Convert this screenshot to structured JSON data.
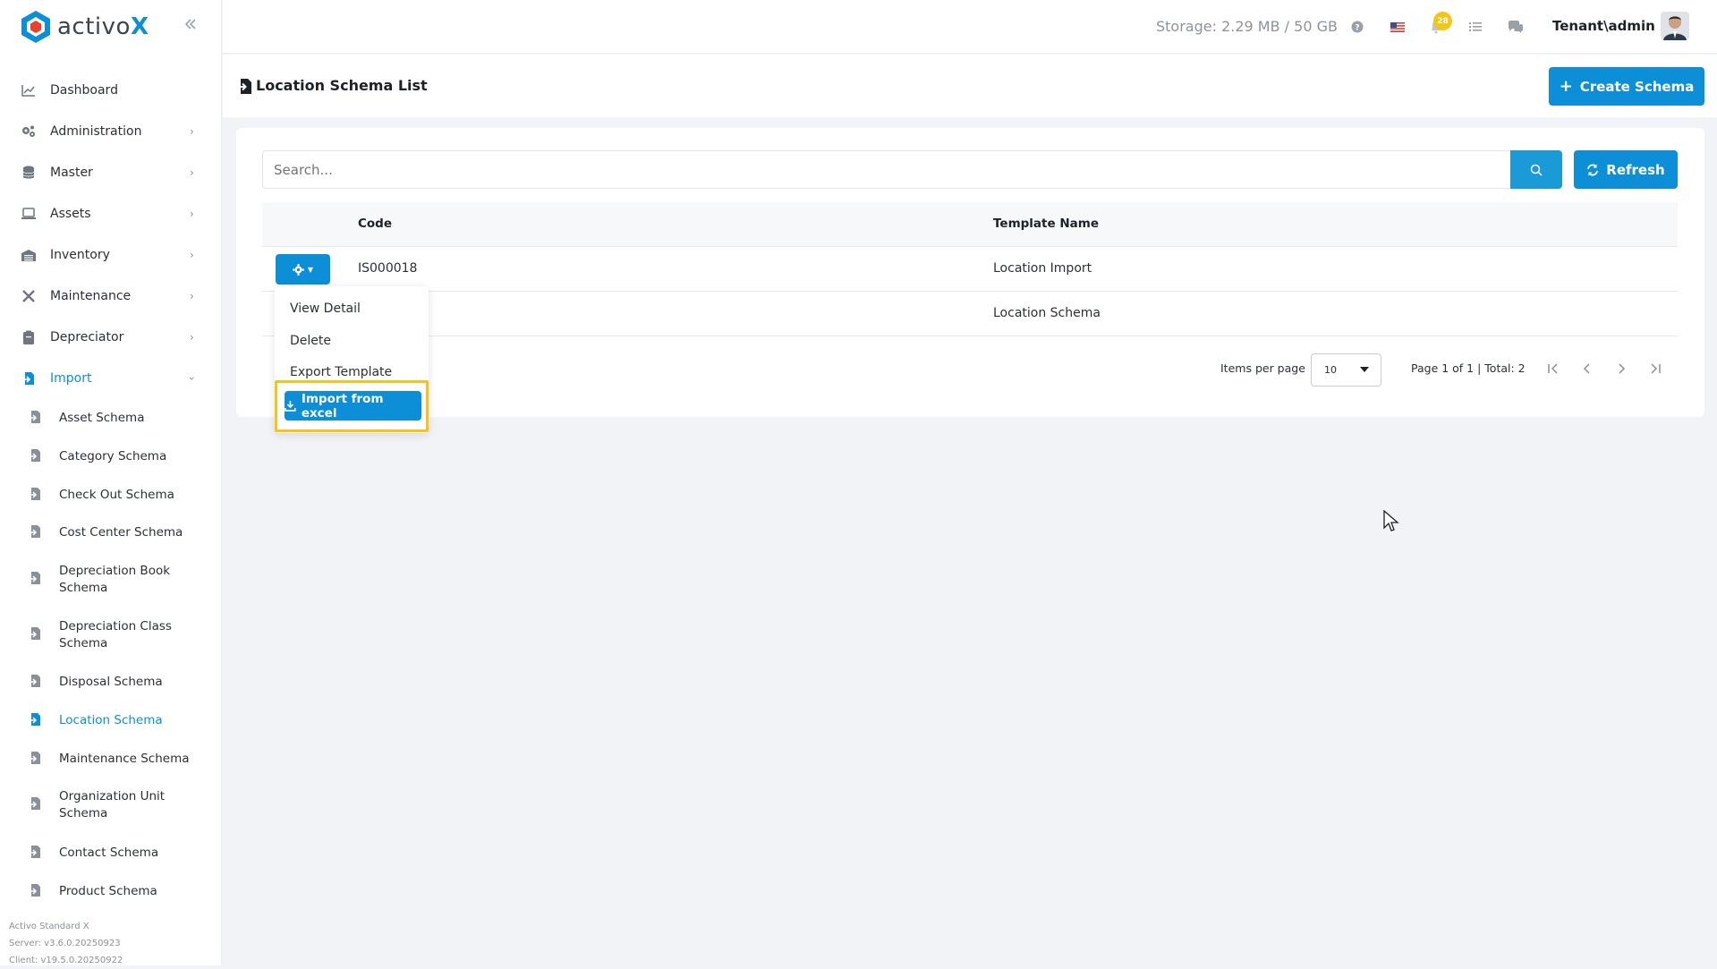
{
  "app": {
    "logo_text": "activo",
    "logo_x": "X"
  },
  "topbar": {
    "storage": "Storage: 2.29 MB / 50 GB",
    "notification_count": "28",
    "user": "Tenant\\admin",
    "icons": [
      "help-icon",
      "flag-us-icon",
      "bell-icon",
      "tasks-icon",
      "chat-icon"
    ]
  },
  "sidebar": {
    "items": [
      {
        "label": "Dashboard",
        "icon": "chart-icon"
      },
      {
        "label": "Administration",
        "icon": "gears-icon"
      },
      {
        "label": "Master",
        "icon": "database-icon"
      },
      {
        "label": "Assets",
        "icon": "laptop-icon"
      },
      {
        "label": "Inventory",
        "icon": "warehouse-icon"
      },
      {
        "label": "Maintenance",
        "icon": "tools-icon"
      },
      {
        "label": "Depreciator",
        "icon": "clipboard-icon"
      },
      {
        "label": "Import",
        "icon": "import-icon"
      }
    ],
    "subitems": [
      "Asset Schema",
      "Category Schema",
      "Check Out Schema",
      "Cost Center Schema",
      "Depreciation Book Schema",
      "Depreciation Class Schema",
      "Disposal Schema",
      "Location Schema",
      "Maintenance Schema",
      "Organization Unit Schema",
      "Contact Schema",
      "Product Schema"
    ],
    "footer": [
      "Activo Standard X",
      "Server: v3.6.0.20250923",
      "Client: v19.5.0.20250922"
    ]
  },
  "page": {
    "title": "Location Schema List",
    "create_label": "Create Schema",
    "search_placeholder": "Search...",
    "refresh_label": "Refresh"
  },
  "table": {
    "columns": [
      "Code",
      "Template Name"
    ],
    "rows": [
      {
        "code": "IS000018",
        "template_name": "Location Import"
      },
      {
        "code": "",
        "template_name": "Location Schema"
      }
    ]
  },
  "dropdown": {
    "items": [
      "View Detail",
      "Delete",
      "Export Template"
    ],
    "import_label": "Import from excel"
  },
  "pagination": {
    "items_per_page_label": "Items per page",
    "items_per_page": "10",
    "info": "Page 1 of 1 | Total: 2"
  },
  "colors": {
    "accent": "#0c8fd6",
    "highlight": "#f7c21b",
    "badge": "#f5c518"
  }
}
